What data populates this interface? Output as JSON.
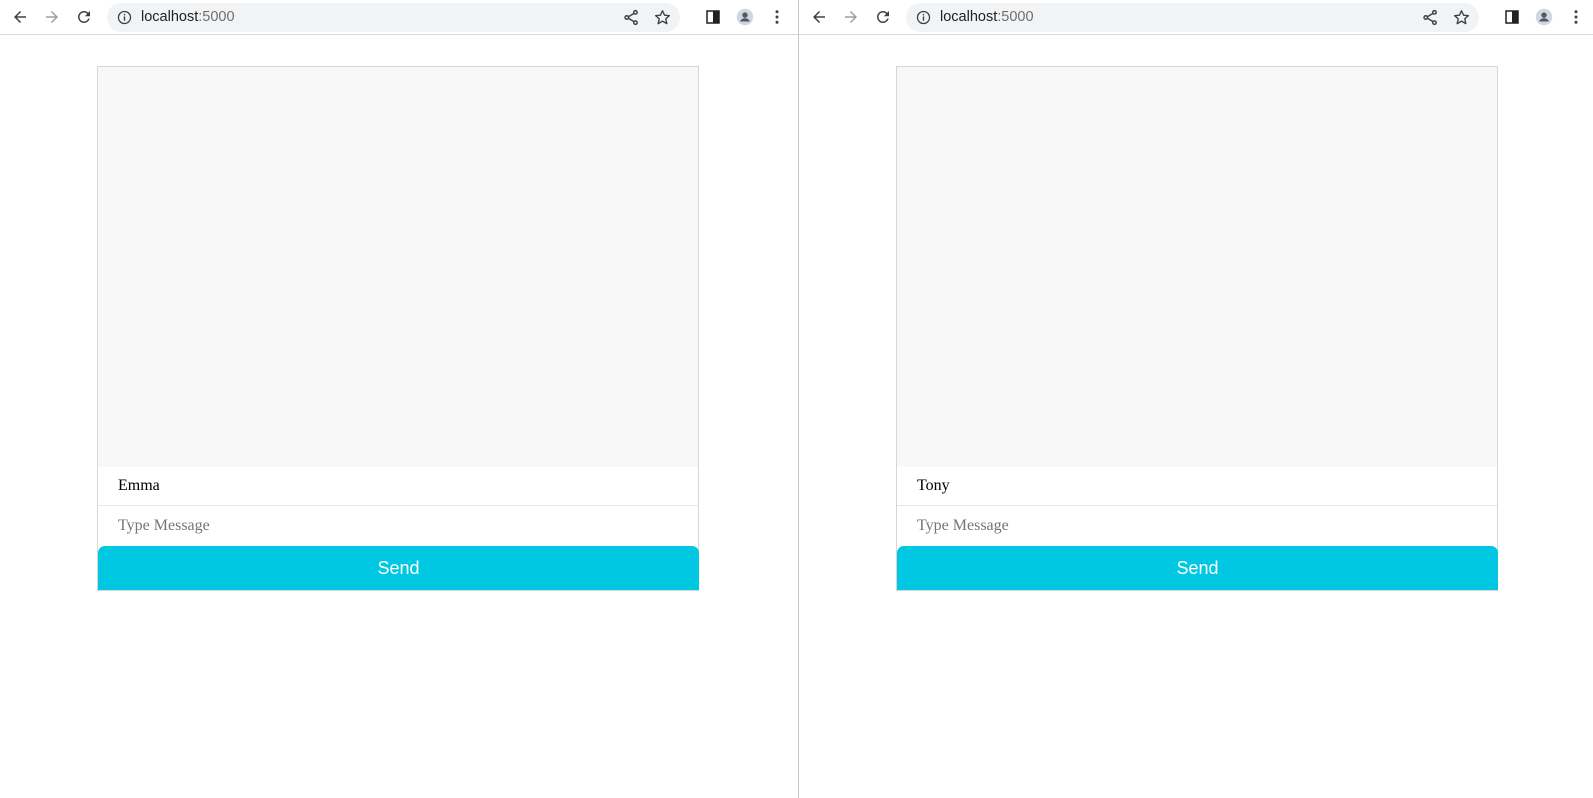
{
  "windows": [
    {
      "id": "left",
      "url_host": "localhost",
      "url_port": ":5000",
      "chat": {
        "name_value": "Emma",
        "message_placeholder": "Type Message",
        "send_label": "Send"
      }
    },
    {
      "id": "right",
      "url_host": "localhost",
      "url_port": ":5000",
      "chat": {
        "name_value": "Tony",
        "message_placeholder": "Type Message",
        "send_label": "Send"
      }
    }
  ],
  "icons": {
    "back": "arrow-left-icon",
    "forward": "arrow-right-icon",
    "reload": "reload-icon",
    "info": "info-icon",
    "share": "share-icon",
    "bookmark": "star-icon",
    "side_panel": "side-panel-icon",
    "profile": "profile-icon",
    "menu": "kebab-menu-icon"
  },
  "colors": {
    "send_button": "#00c8e3",
    "messages_bg": "#f8f8f8",
    "omnibox_bg": "#f1f3f4"
  }
}
